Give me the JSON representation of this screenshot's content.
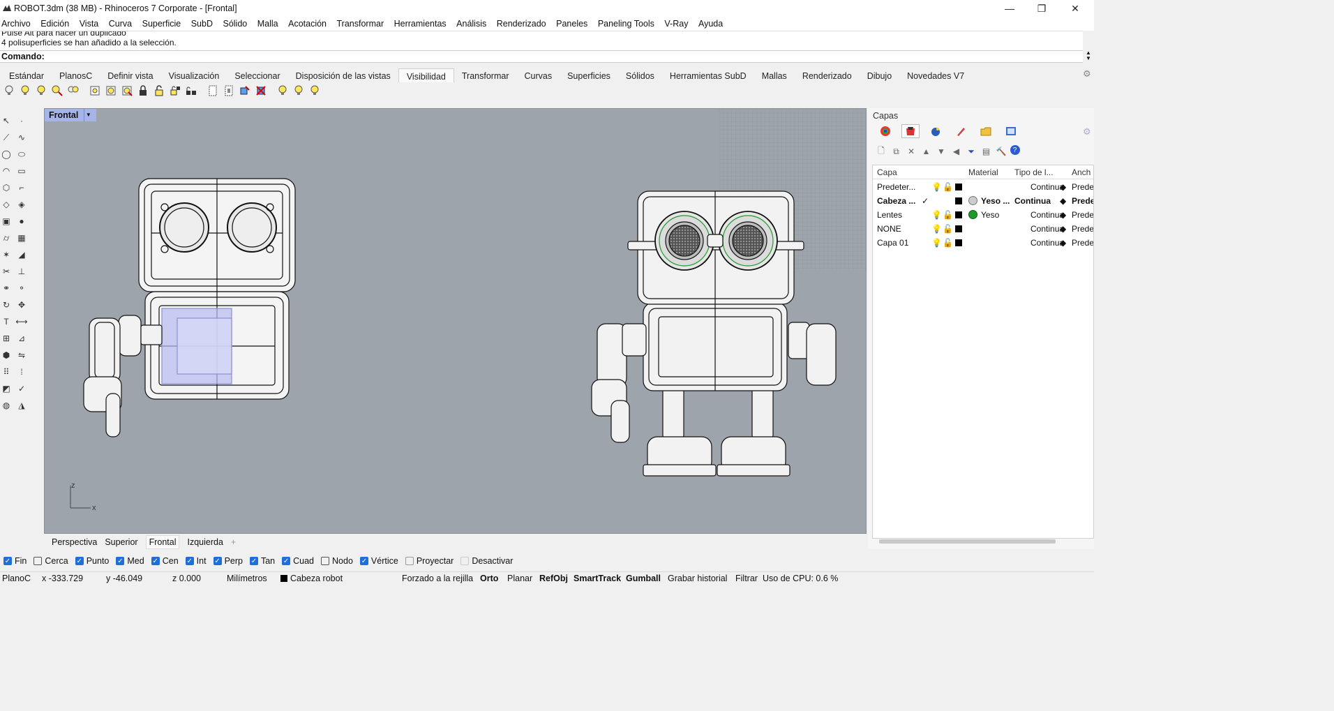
{
  "window": {
    "title": "ROBOT.3dm (38 MB) - Rhinoceros 7 Corporate - [Frontal]",
    "minimize": "—",
    "restore": "❐",
    "close": "✕"
  },
  "menu": [
    "Archivo",
    "Edición",
    "Vista",
    "Curva",
    "Superficie",
    "SubD",
    "Sólido",
    "Malla",
    "Acotación",
    "Transformar",
    "Herramientas",
    "Análisis",
    "Renderizado",
    "Paneles",
    "Paneling Tools",
    "V-Ray",
    "Ayuda"
  ],
  "history": {
    "line1": "Pulse Alt para hacer un duplicado",
    "line2": "4 polisuperficies se han añadido a la selección."
  },
  "command": {
    "label": "Comando:"
  },
  "toolbar_tabs": [
    "Estándar",
    "PlanosC",
    "Definir vista",
    "Visualización",
    "Seleccionar",
    "Disposición de las vistas",
    "Visibilidad",
    "Transformar",
    "Curvas",
    "Superficies",
    "Sólidos",
    "Herramientas SubD",
    "Mallas",
    "Renderizado",
    "Dibujo",
    "Novedades V7"
  ],
  "active_toolbar_tab": "Visibilidad",
  "viewport": {
    "label": "Frontal",
    "axis_z": "z",
    "axis_x": "x"
  },
  "viewport_tabs": [
    "Perspectiva",
    "Superior",
    "Frontal",
    "Izquierda"
  ],
  "viewport_tab_add": "+",
  "active_viewport_tab": "Frontal",
  "layers_panel": {
    "title": "Capas",
    "columns": [
      "Capa",
      "Material",
      "Tipo de l...",
      "Anch"
    ],
    "rows": [
      {
        "name": "Predeter...",
        "current": "",
        "material": "",
        "linetype": "Continua",
        "width": "Prede",
        "bold": false
      },
      {
        "name": "Cabeza ...",
        "current": "✓",
        "material": "Yeso ...",
        "linetype": "Continua",
        "width": "Prede",
        "bold": true
      },
      {
        "name": "Lentes",
        "current": "",
        "material": "Yeso",
        "linetype": "Continua",
        "width": "Prede",
        "bold": false
      },
      {
        "name": "NONE",
        "current": "",
        "material": "",
        "linetype": "Continua",
        "width": "Prede",
        "bold": false
      },
      {
        "name": "Capa 01",
        "current": "",
        "material": "",
        "linetype": "Continua",
        "width": "Prede",
        "bold": false
      }
    ]
  },
  "osnaps": [
    {
      "label": "Fin",
      "checked": true
    },
    {
      "label": "Cerca",
      "checked": false
    },
    {
      "label": "Punto",
      "checked": true
    },
    {
      "label": "Med",
      "checked": true
    },
    {
      "label": "Cen",
      "checked": true
    },
    {
      "label": "Int",
      "checked": true
    },
    {
      "label": "Perp",
      "checked": true
    },
    {
      "label": "Tan",
      "checked": true
    },
    {
      "label": "Cuad",
      "checked": true
    },
    {
      "label": "Nodo",
      "checked": false
    },
    {
      "label": "Vértice",
      "checked": true
    },
    {
      "label": "Proyectar",
      "checked": false
    },
    {
      "label": "Desactivar",
      "checked": false
    }
  ],
  "status": {
    "cplane": "PlanoC",
    "x": "x -333.729",
    "y": "y -46.049",
    "z": "z 0.000",
    "units": "Milímetros",
    "layer": "Cabeza robot",
    "grid_snap": "Forzado a la rejilla",
    "ortho": "Orto",
    "planar": "Planar",
    "osnap": "RefObj",
    "smarttrack": "SmartTrack",
    "gumball": "Gumball",
    "history": "Grabar historial",
    "filter": "Filtrar",
    "cpu": "Uso de CPU: 0.6 %"
  },
  "colors": {
    "viewport_bg": "#9ea4ab",
    "viewport_label_bg": "#a6b4e8",
    "checkbox_on": "#1e6fd9",
    "lens_green": "#1f9a2a"
  }
}
